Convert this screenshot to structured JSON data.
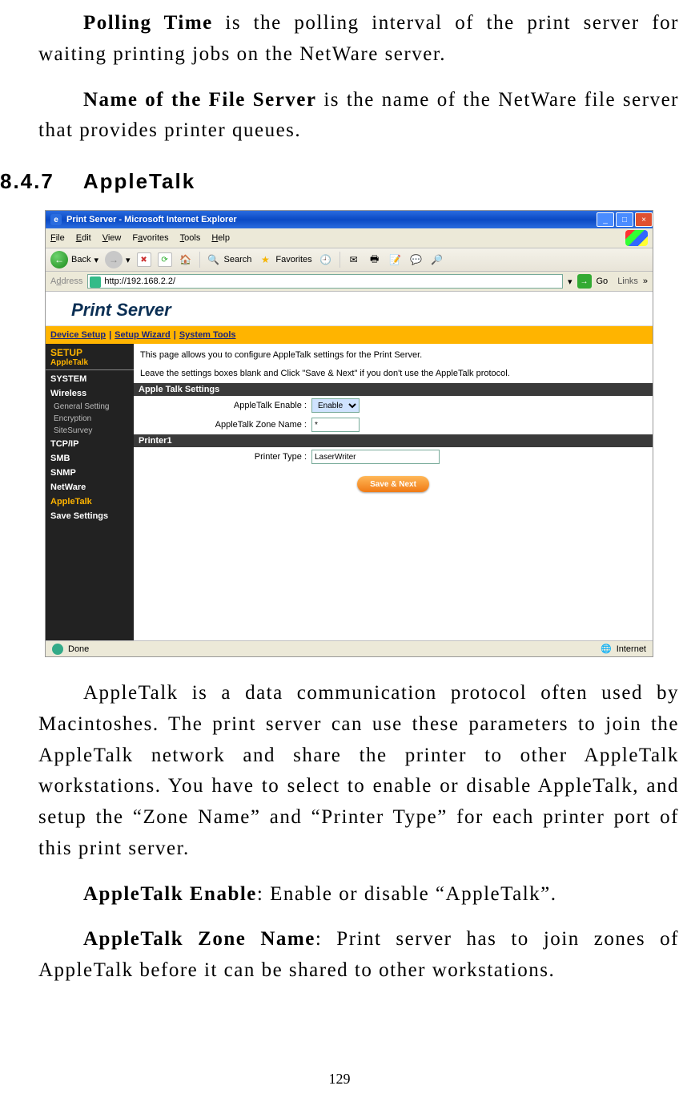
{
  "page_number": "129",
  "doc": {
    "p1_indent_bold": "Polling Time",
    "p1_rest": " is the polling interval of the print server for waiting printing jobs on the NetWare server.",
    "p2_indent_bold": "Name of the File Server",
    "p2_rest": " is the name of the NetWare file server that provides printer queues.",
    "heading_num": "8.4.7",
    "heading_text": "AppleTalk",
    "p3": "AppleTalk is a data communication protocol often used by Macintoshes. The print server can use these parameters to join the AppleTalk network and share the printer to other AppleTalk workstations. You have to select to enable or disable AppleTalk, and setup the “Zone Name” and “Printer Type” for each printer port of this print server.",
    "p4_bold": "AppleTalk Enable",
    "p4_rest": ": Enable or disable “AppleTalk”.",
    "p5_bold": "AppleTalk Zone Name",
    "p5_rest": ": Print server has to join zones of AppleTalk before it can be shared to other workstations."
  },
  "browser": {
    "title": "Print Server - Microsoft Internet Explorer",
    "menus": [
      "File",
      "Edit",
      "View",
      "Favorites",
      "Tools",
      "Help"
    ],
    "back_label": "Back",
    "search_label": "Search",
    "fav_label": "Favorites",
    "addr_label": "Address",
    "address_value": "http://192.168.2.2/",
    "go_label": "Go",
    "links_label": "Links",
    "status_done": "Done",
    "status_net": "Internet"
  },
  "app": {
    "brand": "Print Server",
    "tabs": [
      "Device Setup",
      "Setup Wizard",
      "System Tools"
    ],
    "sidebar": {
      "head": "SETUP",
      "selected": "AppleTalk",
      "items": [
        {
          "label": "SYSTEM",
          "type": "item"
        },
        {
          "label": "Wireless",
          "type": "item"
        },
        {
          "label": "General Setting",
          "type": "sub"
        },
        {
          "label": "Encryption",
          "type": "sub"
        },
        {
          "label": "SiteSurvey",
          "type": "sub"
        },
        {
          "label": "TCP/IP",
          "type": "item"
        },
        {
          "label": "SMB",
          "type": "item"
        },
        {
          "label": "SNMP",
          "type": "item"
        },
        {
          "label": "NetWare",
          "type": "item"
        },
        {
          "label": "AppleTalk",
          "type": "accent"
        },
        {
          "label": "Save Settings",
          "type": "item"
        }
      ]
    },
    "intro_line1": "This page allows you to configure AppleTalk settings for the Print Server.",
    "intro_line2": "Leave the settings boxes blank and Click \"Save & Next\" if you don't use the AppleTalk protocol.",
    "section1": "Apple Talk Settings",
    "enable_label": "AppleTalk Enable :",
    "enable_value": "Enable",
    "zone_label": "AppleTalk Zone Name :",
    "zone_value": "*",
    "section2": "Printer1",
    "ptype_label": "Printer Type :",
    "ptype_value": "LaserWriter",
    "save_btn": "Save & Next"
  }
}
